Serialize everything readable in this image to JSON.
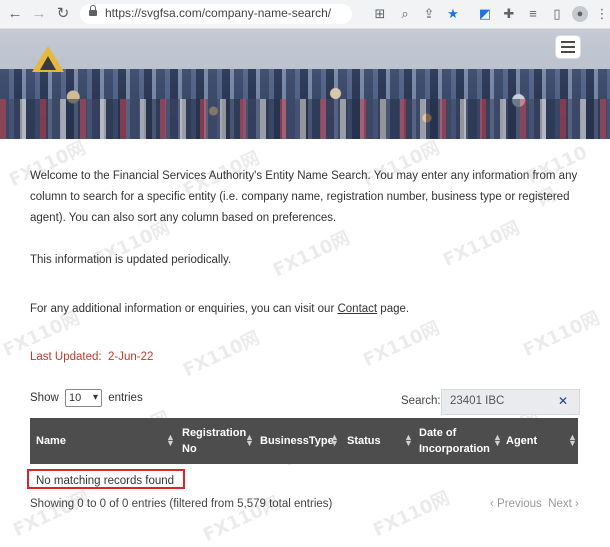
{
  "browser": {
    "url": "https://svgfsa.com/company-name-search/",
    "icons": [
      "back-arrow-icon",
      "forward-arrow-icon",
      "reload-icon",
      "lock-icon",
      "translate-icon",
      "zoom-icon",
      "share-icon",
      "bookmark-star-icon",
      "extension-icon",
      "puzzle-icon",
      "reading-list-icon",
      "side-panel-icon",
      "profile-icon",
      "more-menu-icon"
    ]
  },
  "header": {
    "menu_icon": "hamburger-menu-icon"
  },
  "intro": {
    "welcome": "Welcome to the Financial Services Authority's Entity Name Search. You may enter any information from any column to search for a specific entity (i.e. company name, registration number, business type or registered agent). You can also sort any column based on preferences.",
    "periodic": "This information is updated periodically.",
    "contact_before": "For any additional information or enquiries, you can visit our ",
    "contact_link": "Contact",
    "contact_after": " page.",
    "last_updated_label": "Last Updated:",
    "last_updated_value": "2-Jun-22"
  },
  "controls": {
    "show_label": "Show",
    "entries_value": "10",
    "entries_label": "entries",
    "search_label": "Search:",
    "search_value": "23401 IBC"
  },
  "table": {
    "columns": [
      "Name",
      "Registration No",
      "BusinessType",
      "Status",
      "Date of Incorporation",
      "Agent"
    ],
    "empty_message": "No matching records found"
  },
  "footer": {
    "showing": "Showing 0 to 0 of 0 entries (filtered from 5,579 total entries)",
    "previous": "Previous",
    "next": "Next"
  },
  "watermark": "FX110网",
  "colors": {
    "accent_red": "#c0392b",
    "table_header": "#4d4d4d",
    "highlight_border": "#d9262c",
    "link_blue": "#1f3d8a"
  }
}
